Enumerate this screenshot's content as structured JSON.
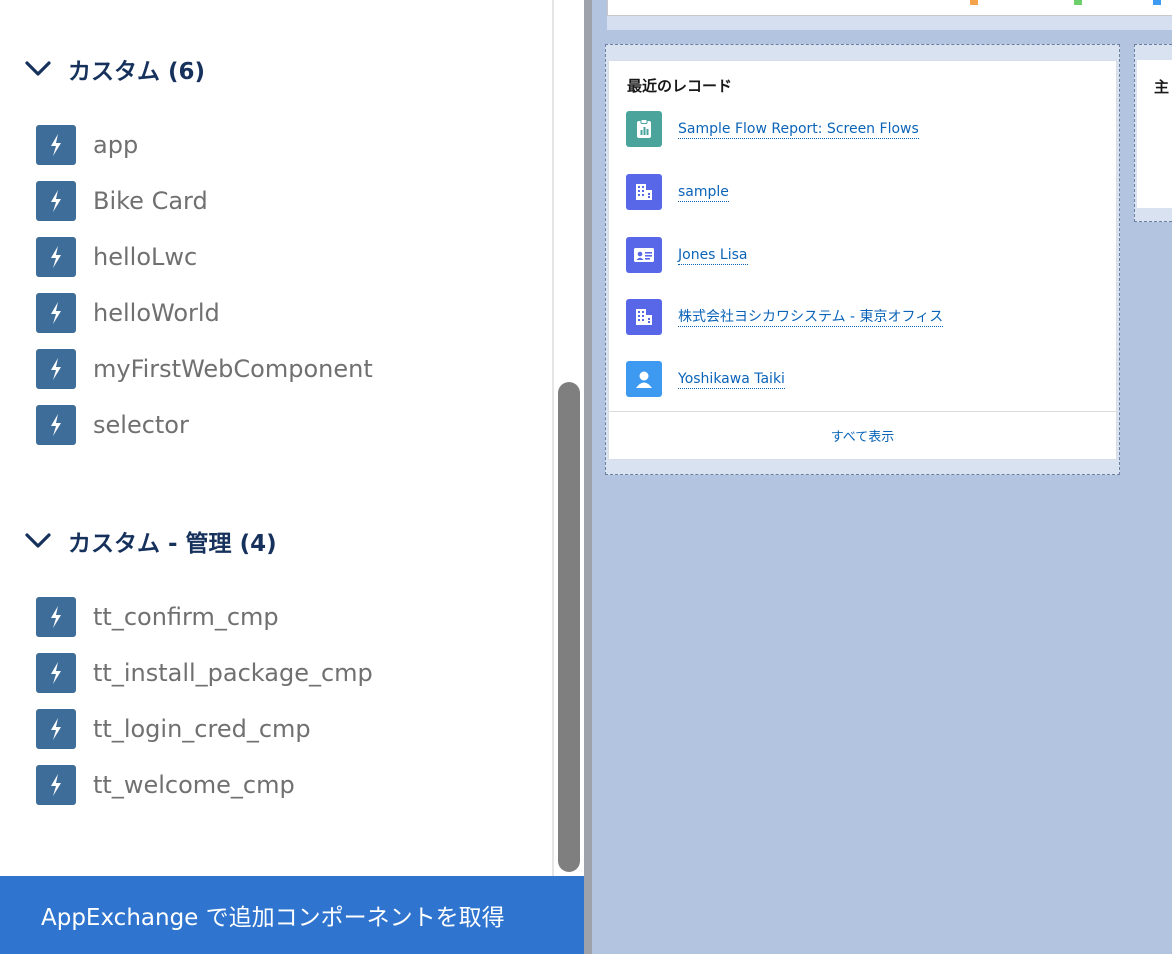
{
  "sections": [
    {
      "title": "カスタム (6)",
      "items": [
        "app",
        "Bike Card",
        "helloLwc",
        "helloWorld",
        "myFirstWebComponent",
        "selector"
      ]
    },
    {
      "title": "カスタム - 管理 (4)",
      "items": [
        "tt_confirm_cmp",
        "tt_install_package_cmp",
        "tt_login_cred_cmp",
        "tt_welcome_cmp"
      ]
    }
  ],
  "appexchange_button": "AppExchange で追加コンポーネントを取得",
  "recent_records": {
    "title": "最近のレコード",
    "records": [
      {
        "label": "Sample Flow Report: Screen Flows",
        "icon": "report-icon",
        "color": "#4aa49c"
      },
      {
        "label": "sample",
        "icon": "account-icon",
        "color": "#5867e8"
      },
      {
        "label": "Jones Lisa",
        "icon": "contact-icon",
        "color": "#5867e8"
      },
      {
        "label": "株式会社ヨシカワシステム - 東京オフィス",
        "icon": "account-icon",
        "color": "#5867e8"
      },
      {
        "label": "Yoshikawa Taiki",
        "icon": "user-icon",
        "color": "#3d9af0"
      }
    ],
    "view_all": "すべて表示"
  },
  "side_card": {
    "title": "主"
  },
  "colors": {
    "section_title": "#16325c",
    "component_icon": "#3e6d9a",
    "appexchange_bg": "#2f75cf",
    "canvas_bg": "#b3c4e0",
    "link": "#0b64b8"
  }
}
